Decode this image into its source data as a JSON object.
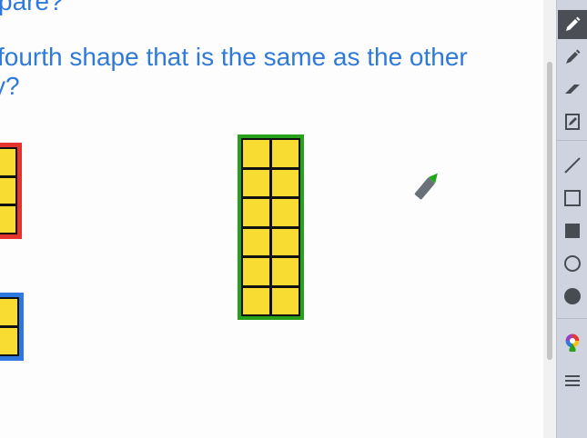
{
  "question": {
    "line1": "pare?",
    "line2": "fourth shape that is the same as the other",
    "line3": "y?"
  },
  "shapes": [
    {
      "name": "red",
      "border_color": "#e4342d",
      "fill": "#f9dc31",
      "columns": 2,
      "rows": 3
    },
    {
      "name": "blue",
      "border_color": "#2e78e0",
      "fill": "#f9dc31",
      "columns": 2,
      "rows": 2
    },
    {
      "name": "green",
      "border_color": "#27a01c",
      "fill": "#f9dc31",
      "columns": 2,
      "rows": 6
    }
  ],
  "cursor": {
    "icon": "marker-cursor-icon",
    "tip_color": "#1fa81a",
    "body_color": "#6b7179"
  },
  "toolbar": {
    "background": "#cfd3e0",
    "tools": [
      {
        "name": "pen-tool",
        "icon": "pen-icon",
        "active": true
      },
      {
        "name": "marker-tool",
        "icon": "marker-icon",
        "active": false
      },
      {
        "name": "eraser-tool",
        "icon": "eraser-icon",
        "active": false
      },
      {
        "name": "note-tool",
        "icon": "note-edit-icon",
        "active": false
      },
      {
        "name": "line-tool",
        "icon": "line-icon",
        "active": false
      },
      {
        "name": "rectangle-tool",
        "icon": "rectangle-outline-icon",
        "active": false
      },
      {
        "name": "filled-rectangle-tool",
        "icon": "rectangle-filled-icon",
        "active": false
      },
      {
        "name": "circle-tool",
        "icon": "circle-outline-icon",
        "active": false
      },
      {
        "name": "filled-circle-tool",
        "icon": "circle-filled-icon",
        "active": false
      },
      {
        "name": "color-picker-tool",
        "icon": "color-palette-icon",
        "active": false
      },
      {
        "name": "menu-tool",
        "icon": "hamburger-menu-icon",
        "active": false
      }
    ]
  }
}
